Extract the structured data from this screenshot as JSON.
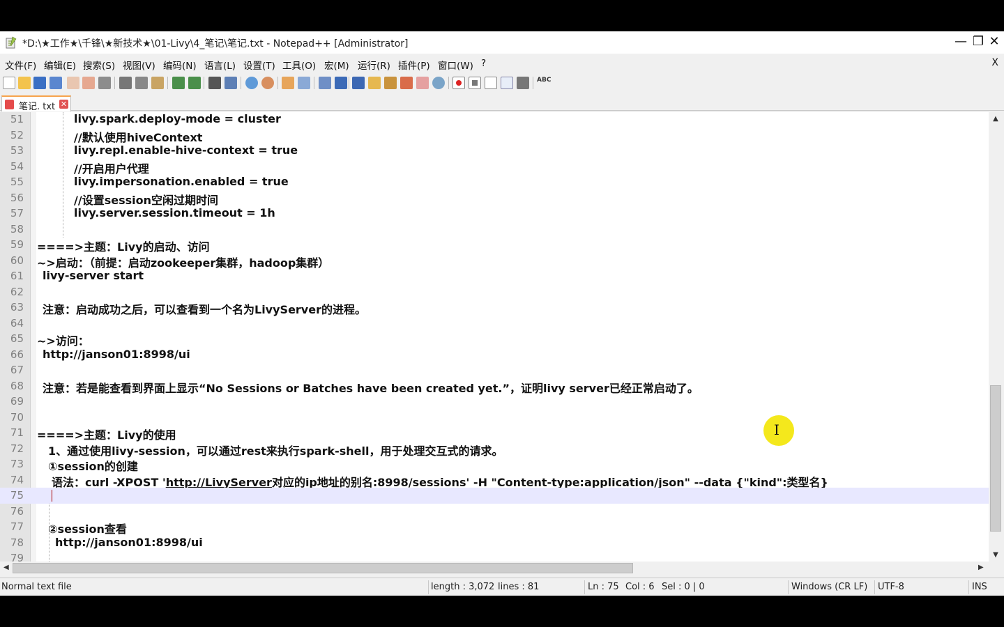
{
  "window": {
    "title": "*D:\\★工作★\\千锋\\★新技术★\\01-Livy\\4_笔记\\笔记.txt - Notepad++ [Administrator]",
    "controls": {
      "minimize": "—",
      "restore": "❐",
      "close": "✕"
    }
  },
  "menu": {
    "items": [
      "文件(F)",
      "编辑(E)",
      "搜索(S)",
      "视图(V)",
      "编码(N)",
      "语言(L)",
      "设置(T)",
      "工具(O)",
      "宏(M)",
      "运行(R)",
      "插件(P)",
      "窗口(W)",
      "?"
    ],
    "close": "X"
  },
  "toolbar": {
    "buttons": [
      "new-file-icon",
      "open-file-icon",
      "save-icon",
      "save-all-icon",
      "close-icon",
      "close-all-icon",
      "print-icon",
      "cut-icon",
      "copy-icon",
      "paste-icon",
      "undo-icon",
      "redo-icon",
      "find-icon",
      "replace-icon",
      "zoom-in-icon",
      "zoom-out-icon",
      "sync-vertical-icon",
      "sync-horizontal-icon",
      "word-wrap-icon",
      "show-all-chars-icon",
      "indent-guide-icon",
      "lang-udl-icon",
      "doc-map-icon",
      "function-list-icon",
      "folder-workspace-icon",
      "monitoring-icon",
      "record-macro-icon",
      "stop-macro-icon",
      "play-macro-icon",
      "run-macro-multiple-icon",
      "save-macro-icon",
      "spell-check-icon"
    ]
  },
  "tab": {
    "label": "笔记. txt"
  },
  "editor": {
    "lines": [
      {
        "n": "51",
        "text": "livy.spark.deploy-mode = cluster",
        "indent": "i5"
      },
      {
        "n": "52",
        "text": "//默认使用hiveContext",
        "indent": "i5"
      },
      {
        "n": "53",
        "text": "livy.repl.enable-hive-context = true",
        "indent": "i5"
      },
      {
        "n": "54",
        "text": "//开启用户代理",
        "indent": "i5"
      },
      {
        "n": "55",
        "text": "livy.impersonation.enabled = true",
        "indent": "i5"
      },
      {
        "n": "56",
        "text": "//设置session空闲过期时间",
        "indent": "i5"
      },
      {
        "n": "57",
        "text": "livy.server.session.timeout = 1h",
        "indent": "i5"
      },
      {
        "n": "58",
        "text": "",
        "indent": "i5"
      },
      {
        "n": "59",
        "text": "====>主题：Livy的启动、访问",
        "indent": ""
      },
      {
        "n": "60",
        "text": "~>启动：（前提：启动zookeeper集群，hadoop集群）",
        "indent": ""
      },
      {
        "n": "61",
        "text": "livy-server start",
        "indent": "i1"
      },
      {
        "n": "62",
        "text": "",
        "indent": ""
      },
      {
        "n": "63",
        "text": "注意：启动成功之后，可以查看到一个名为LivyServer的进程。",
        "indent": "i1"
      },
      {
        "n": "64",
        "text": "",
        "indent": ""
      },
      {
        "n": "65",
        "text": "~>访问：",
        "indent": ""
      },
      {
        "n": "66",
        "text": "http://janson01:8998/ui",
        "indent": "i1",
        "link": true
      },
      {
        "n": "67",
        "text": "",
        "indent": ""
      },
      {
        "n": "68",
        "text": "注意：若是能查看到界面上显示“No Sessions or Batches have been created yet.”，证明livy server已经正常启动了。",
        "indent": "i1"
      },
      {
        "n": "69",
        "text": "",
        "indent": ""
      },
      {
        "n": "70",
        "text": "",
        "indent": ""
      },
      {
        "n": "71",
        "text": "====>主题：Livy的使用",
        "indent": ""
      },
      {
        "n": "72",
        "text": "1、通过使用livy-session，可以通过rest来执行spark-shell，用于处理交互式的请求。",
        "indent": "i2"
      },
      {
        "n": "73",
        "text": "①session的创建",
        "indent": "i2"
      },
      {
        "n": "74",
        "text": "",
        "indent": "i3",
        "composite": true
      },
      {
        "n": "75",
        "text": "",
        "indent": "i3",
        "current": true
      },
      {
        "n": "76",
        "text": "",
        "indent": ""
      },
      {
        "n": "77",
        "text": "②session查看",
        "indent": "i2"
      },
      {
        "n": "78",
        "text": "http://janson01:8998/ui",
        "indent": "i4",
        "link": true
      },
      {
        "n": "79",
        "text": "",
        "indent": ""
      }
    ],
    "line74": {
      "prefix": "语法：curl -XPOST '",
      "link": "http://LivyServer",
      "suffix": "对应的ip地址的别名:8998/sessions' -H \"Content-type:application/json\" --data {\"kind\":类型名}"
    }
  },
  "status": {
    "file_type": "Normal text file",
    "length": "length : 3,072",
    "lines": "lines : 81",
    "ln": "Ln : 75",
    "col": "Col : 6",
    "sel": "Sel : 0 | 0",
    "eol": "Windows (CR LF)",
    "encoding": "UTF-8",
    "mode": "INS"
  }
}
